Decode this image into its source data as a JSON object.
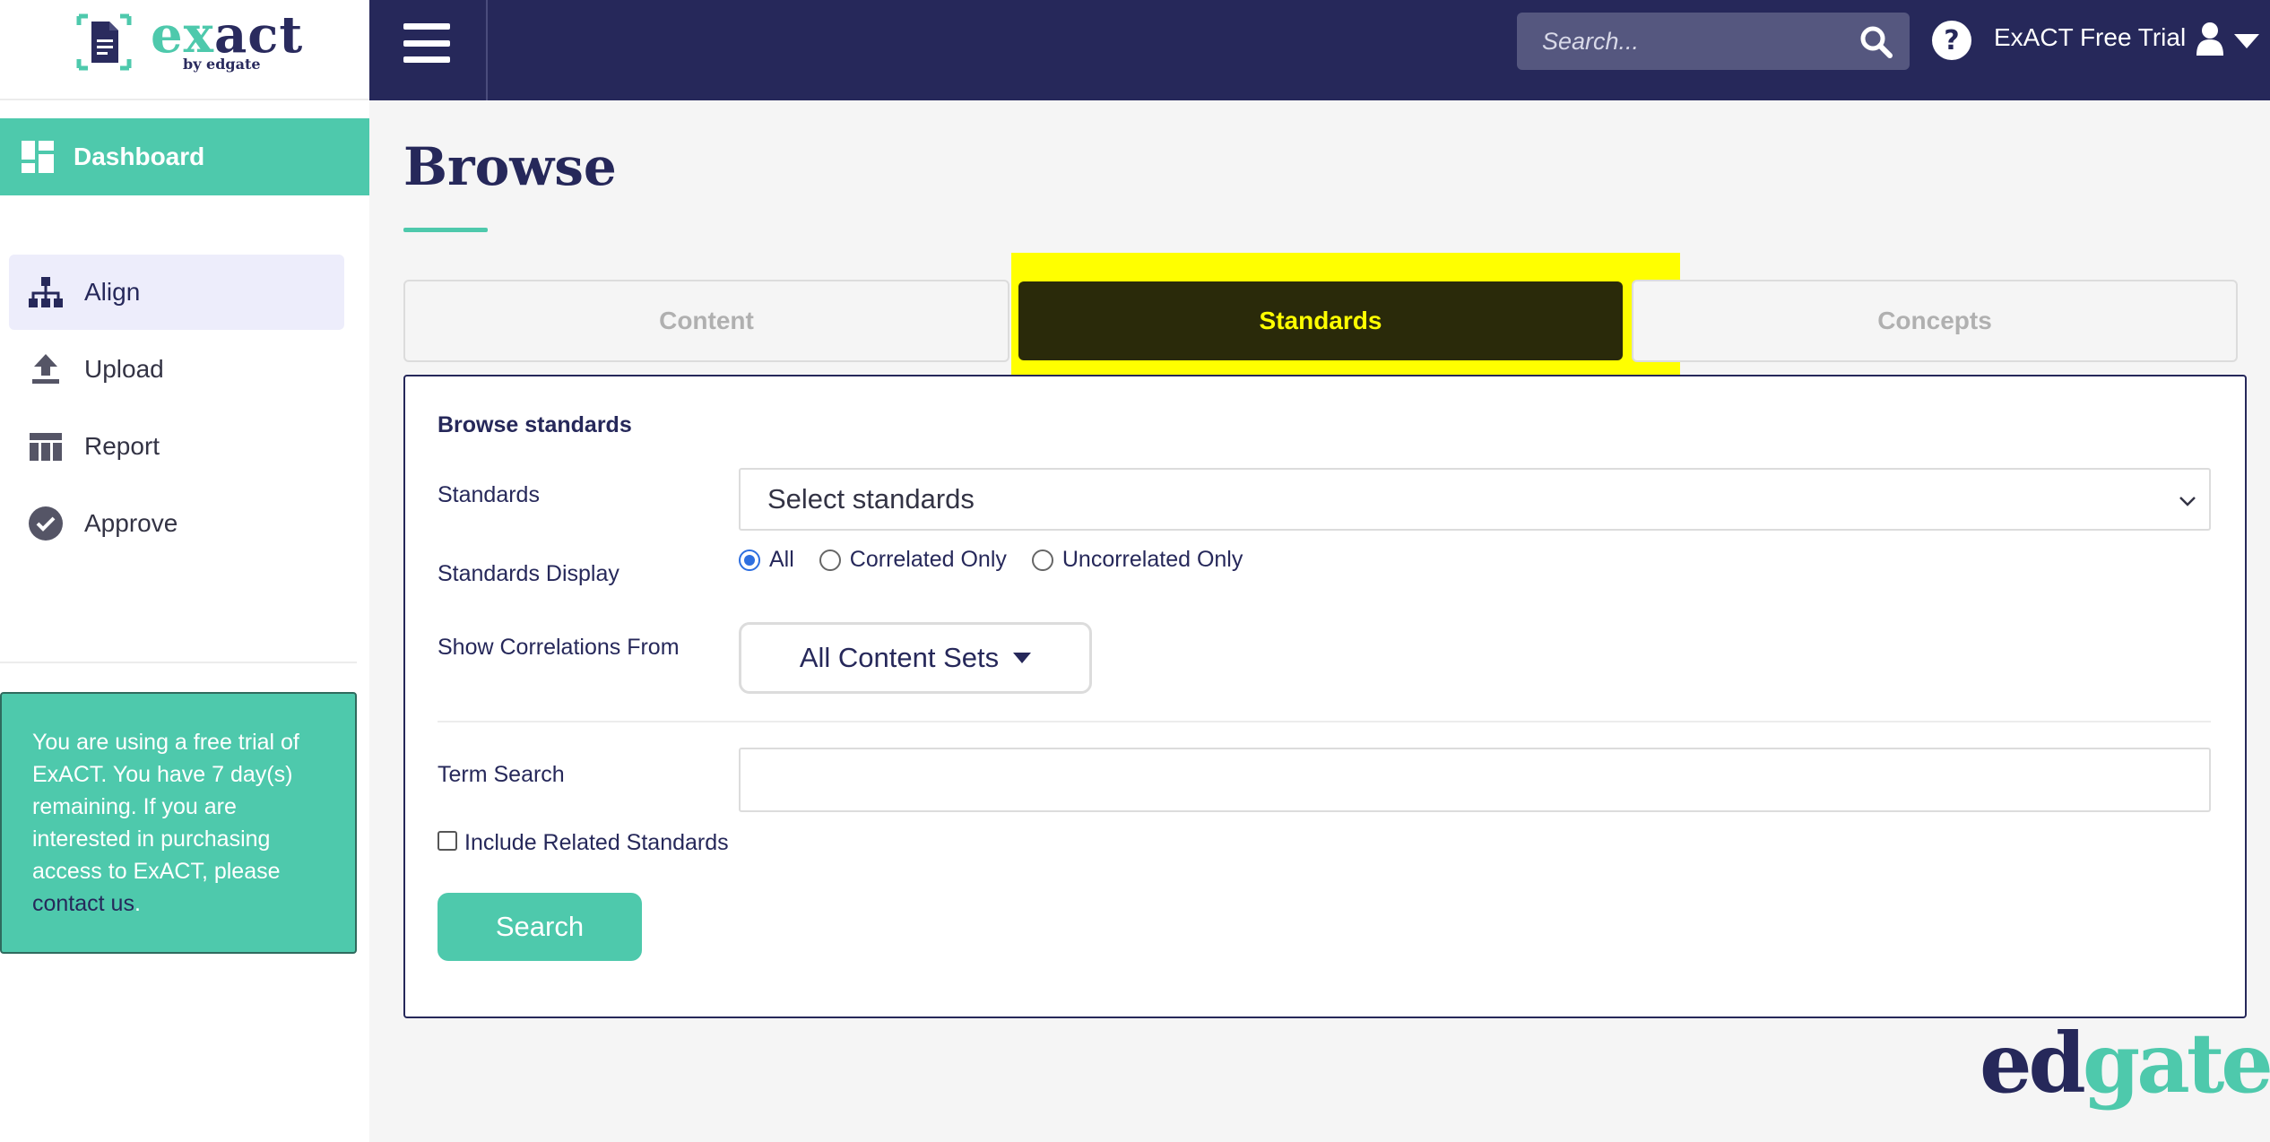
{
  "brand": {
    "logo_main": "exact",
    "logo_main_accent": "ex",
    "logo_main_rest": "act",
    "logo_sub": "by edgate",
    "footer_logo_dark": "ed",
    "footer_logo_accent": "gate",
    "colors": {
      "navy": "#26285a",
      "teal": "#4ec9ac",
      "highlight": "#ffff00"
    }
  },
  "header": {
    "search_placeholder": "Search...",
    "user_name": "ExACT Free Trial",
    "icons": [
      "hamburger-menu-icon",
      "search-icon",
      "help-icon",
      "user-icon",
      "caret-down-icon"
    ]
  },
  "sidebar": {
    "dashboard_label": "Dashboard",
    "items": [
      {
        "label": "Align",
        "icon": "hierarchy-icon",
        "active": true
      },
      {
        "label": "Upload",
        "icon": "upload-icon",
        "active": false
      },
      {
        "label": "Report",
        "icon": "table-icon",
        "active": false
      },
      {
        "label": "Approve",
        "icon": "check-circle-icon",
        "active": false
      }
    ],
    "trial_text": "You are using a free trial of ExACT. You have 7 day(s) remaining. If you are interested in purchasing access to ExACT, please ",
    "trial_link": "contact us",
    "trial_end": "."
  },
  "main": {
    "title": "Browse",
    "tabs": [
      {
        "label": "Content",
        "active": false
      },
      {
        "label": "Standards",
        "active": true
      },
      {
        "label": "Concepts",
        "active": false
      }
    ],
    "panel": {
      "heading": "Browse standards",
      "standards_label": "Standards",
      "standards_select_value": "Select standards",
      "display_label": "Standards Display",
      "display_options": [
        {
          "label": "All",
          "checked": true
        },
        {
          "label": "Correlated Only",
          "checked": false
        },
        {
          "label": "Uncorrelated Only",
          "checked": false
        }
      ],
      "correlations_label": "Show Correlations From",
      "correlations_value": "All Content Sets",
      "term_label": "Term Search",
      "term_value": "",
      "related_label": "Include Related Standards",
      "related_checked": false,
      "search_button": "Search"
    }
  }
}
